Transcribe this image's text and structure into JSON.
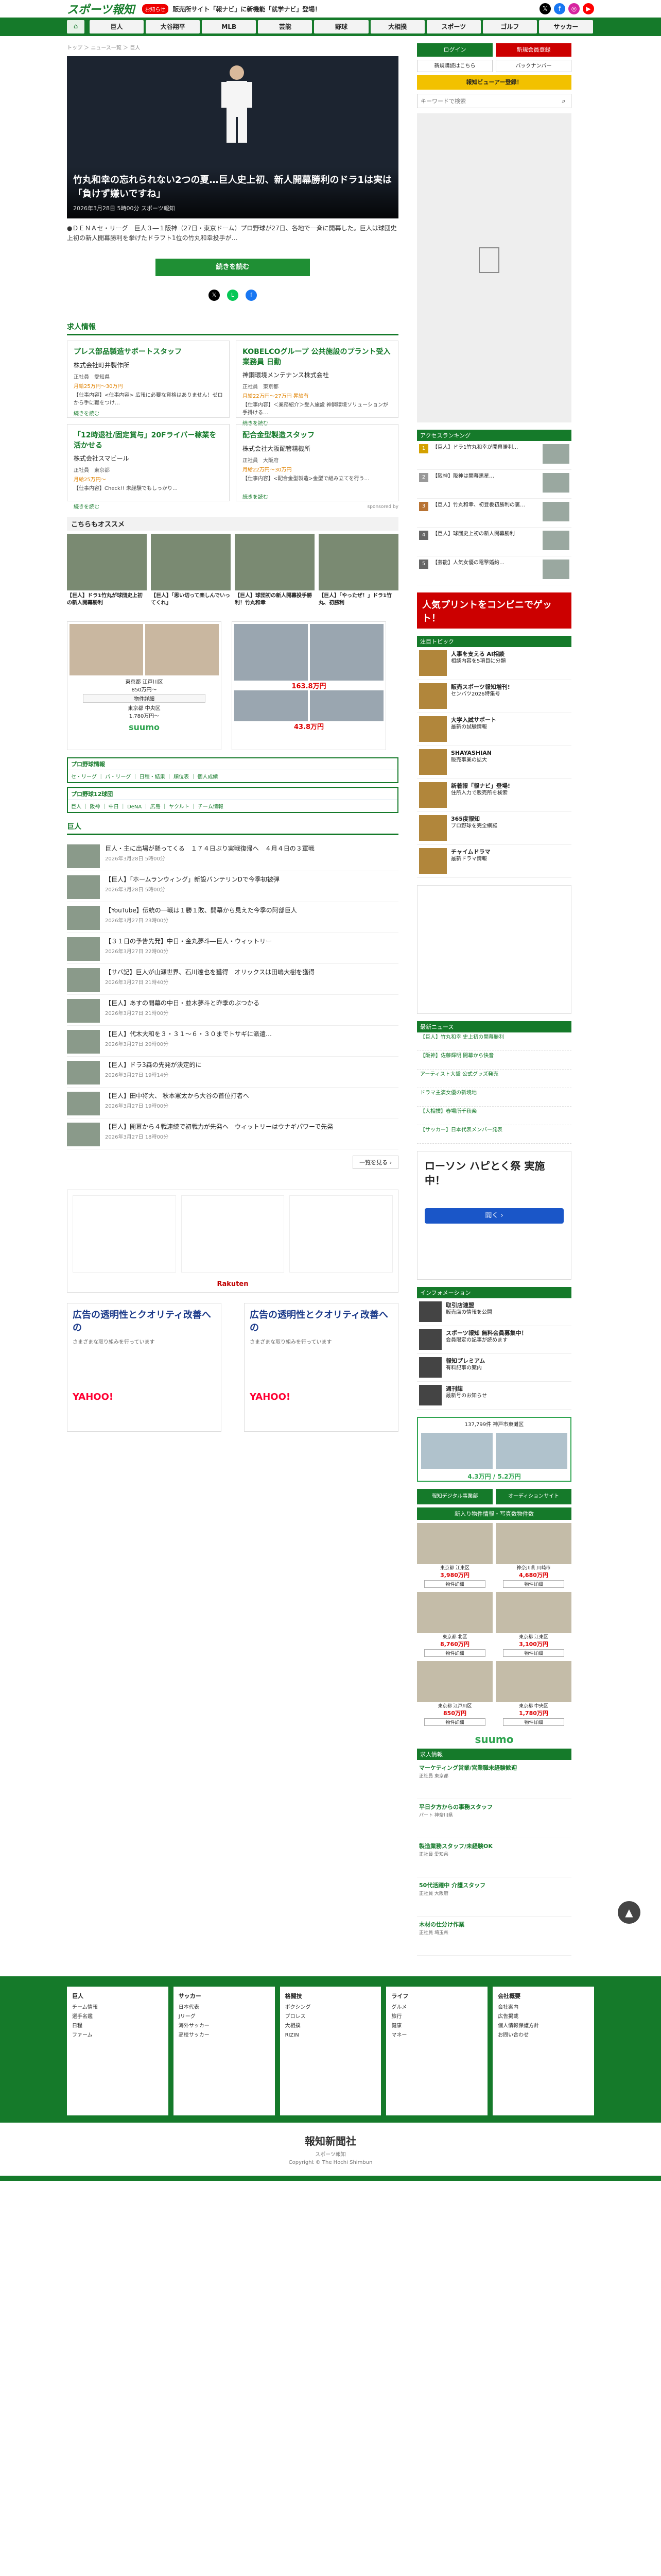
{
  "header": {
    "logo": "スポーツ報知",
    "promo_tag": "お知らせ",
    "promo_text": "販売所サイト「報ナビ」に新機能「就学ナビ」登場！"
  },
  "nav": {
    "home": "⌂",
    "items": [
      "巨人",
      "大谷翔平",
      "MLB",
      "芸能",
      "野球",
      "大相撲",
      "スポーツ",
      "ゴルフ",
      "サッカー"
    ]
  },
  "breadcrumb": "トップ ＞ ニュース一覧 ＞ 巨人",
  "hero": {
    "title": "竹丸和幸の忘れられない2つの夏…巨人史上初、新人開幕勝利のドラ1は実は「負けず嫌いですね」",
    "meta": "2026年3月28日 5時00分 スポーツ報知",
    "lead": "●ＤＥＮＡセ・リーグ　巨人３―１阪神（27日・東京ドーム）プロ野球が27日、各地で一斉に開幕した。巨人は球団史上初の新人開幕勝利を挙げたドラフト1位の竹丸和幸投手が…",
    "more": "続きを読む"
  },
  "jobs_title": "求人情報",
  "jobs": [
    {
      "title": "プレス部品製造サポートスタッフ",
      "company": "株式会社町井製作所",
      "pref": "正社員",
      "loc": "愛知県",
      "salary": "月給25万円〜30万円",
      "desc": "【仕事内容】<仕事内容> 広報に必要な資格はありません！ゼロから手に職をつけ…",
      "more": "続きを読む"
    },
    {
      "title": "KOBELCOグループ 公共施設のプラント受入業務員 日勤",
      "company": "神鋼環境メンテナンス株式会社",
      "pref": "正社員",
      "loc": "東京都",
      "salary": "月給22万円〜27万円 昇給有",
      "desc": "【仕事内容】＜業務紹介＞受入施設 神鋼環境ソリューションが手掛ける…",
      "more": "続きを読む"
    },
    {
      "title": "「12時退社/固定賞与」20Fライバー稼業を活かせる",
      "company": "株式会社スマビール",
      "pref": "正社員",
      "loc": "東京都",
      "salary": "月給25万円〜",
      "desc": "【仕事内容】Check!! 未経験でもしっかり…",
      "more": "続きを読む"
    },
    {
      "title": "配合金型製造スタッフ",
      "company": "株式会社大阪配管精機所",
      "pref": "正社員",
      "loc": "大阪府",
      "salary": "月給22万円〜30万円",
      "desc": "【仕事内容】<配合金型製造>金型で組み立てを行う…",
      "more": "続きを読む"
    }
  ],
  "sponsored": "sponsored by",
  "reco": {
    "title": "こちらもオススメ",
    "items": [
      "【巨人】ドラ1竹丸が球団史上初の新人開幕勝利",
      "【巨人】「思い切って楽しんでいってくれ」",
      "【巨人】球団初の新人開幕投手勝利！竹丸和幸",
      "【巨人】「やったぜ！」ドラ1竹丸、初勝利"
    ]
  },
  "suumo_ad": {
    "p1": "東京都 江戸川区",
    "v1": "850万円〜",
    "p2": "東京都 中央区",
    "v2": "1,780万円〜",
    "btn": "物件詳細",
    "logo": "suumo"
  },
  "car_ad": {
    "p1": "163.8万円",
    "p2": "43.8万円"
  },
  "linkbox1": {
    "h": "プロ野球情報",
    "l": "セ・リーグ ｜ パ・リーグ ｜ 日程・結果 ｜ 順位表 ｜ 個人成績"
  },
  "linkbox2": {
    "h": "プロ野球12球団",
    "l": "巨人 ｜ 阪神 ｜ 中日 ｜ DeNA ｜ 広島 ｜ ヤクルト ｜ チーム情報"
  },
  "news_title": "巨人",
  "news": [
    {
      "t": "巨人・主に出場が懸ってくる　１７４日ぶり実戦復帰へ　４月４日の３軍戦",
      "d": "2026年3月28日 5時00分"
    },
    {
      "t": "【巨人】「ホームランウィング」新設バンテリンDで今季初被弾",
      "d": "2026年3月28日 5時00分"
    },
    {
      "t": "【YouTube】伝統の一戦は１勝１敗、開幕から見えた今季の阿部巨人",
      "d": "2026年3月27日 23時00分"
    },
    {
      "t": "【３１日の予告先発】中日・金丸夢斗―巨人・ウィットリー",
      "d": "2026年3月27日 22時00分"
    },
    {
      "t": "【サバ記】巨人が山瀬世界、石川達也を獲得　オリックスは田嶋大樹を獲得",
      "d": "2026年3月27日 21時40分"
    },
    {
      "t": "【巨人】あすの開幕の中日・並木夢斗と昨季のぶつかる",
      "d": "2026年3月27日 21時00分"
    },
    {
      "t": "【巨人】代木大和を３・３１〜６・３０までトサギに派遣…",
      "d": "2026年3月27日 20時00分"
    },
    {
      "t": "【巨人】ドラ3森の先発が決定的に",
      "d": "2026年3月27日 19時14分"
    },
    {
      "t": "【巨人】田中将大、 秋本憲太から大谷の首位打者へ",
      "d": "2026年3月27日 19時00分"
    },
    {
      "t": "【巨人】開幕から４戦連続で初戦力が先発へ　ウィットリーはウナギパワーで先発",
      "d": "2026年3月27日 18時00分"
    }
  ],
  "list_more": "一覧を見る ›",
  "rakuten_logo": "Rakuten",
  "yahoo_ads": [
    {
      "t": "広告の透明性とクオリティ改善への",
      "s": "さまざまな取り組みを行っています",
      "y": "YAHOO!"
    },
    {
      "t": "広告の透明性とクオリティ改善への",
      "s": "さまざまな取り組みを行っています",
      "y": "YAHOO!"
    }
  ],
  "side": {
    "login": "ログイン",
    "register": "新規会員登録",
    "b1": "新規購読はこちら",
    "b2": "バックナンバー",
    "viewer": "報知ビューアー登録！",
    "search_placeholder": "キーワードで検索",
    "access": "アクセスランキング",
    "ranks": [
      "【巨人】ドラ1竹丸和幸が開幕勝利…",
      "【阪神】阪神は開幕黒星…",
      "【巨人】竹丸和幸、初登板初勝利の裏…",
      "【巨人】球団史上初の新人開幕勝利",
      "【芸能】人気女優の電撃婚約…"
    ],
    "print": "人気プリントをコンビニでゲット！",
    "pr_title": "注目トピック",
    "pr": [
      {
        "b": "人事を支える AI相談",
        "t": "相談内容を5項目に分類"
      },
      {
        "b": "販売スポーツ報知増刊!",
        "t": "センバツ2026特集号"
      },
      {
        "b": "大学入試サポート",
        "t": "最新の試験情報"
      },
      {
        "b": "SHAYASHIAN",
        "t": "販売事業の拡大"
      },
      {
        "b": "新着報「報ナビ」登場!",
        "t": "住所入力で販売所を検索"
      },
      {
        "b": "365度報知",
        "t": "プロ野球を完全網羅"
      },
      {
        "b": "チャイムドラマ",
        "t": "最新ドラマ情報"
      }
    ],
    "recent_title": "最新ニュース",
    "recent": [
      "【巨人】竹丸和幸 史上初の開幕勝利",
      "【阪神】佐藤輝明 開幕から快音",
      "アーティスト大盤 公式グッズ発売",
      "ドラマ主演女優の新境地",
      "【大相撲】春場所千秋楽",
      "【サッカー】日本代表メンバー発表"
    ],
    "lawson_t": "ローソン ハピとく祭 実施中！",
    "lawson_btn": "開く ›",
    "info_title": "インフォメーション",
    "info": [
      {
        "b": "取引店連盟",
        "t": "販売店の情報を公開"
      },
      {
        "b": "スポーツ報知 無料会員募集中！",
        "t": "会員限定の記事が読めます"
      },
      {
        "b": "報知プレミアム",
        "t": "有料記事の案内"
      },
      {
        "b": "週刊誌",
        "t": "最新号のお知らせ"
      }
    ],
    "chintai_h": "137,799件 神戸市東灘区",
    "chintai_p": "4.3万円 / 5.2万円",
    "pair1": "報知デジタル事業部",
    "pair2": "オーディションサイト",
    "prop_title": "新入り物件情報・写真数物件数",
    "props": [
      {
        "a": "東京都 江東区",
        "p": "3,980万円",
        "b": "物件詳細"
      },
      {
        "a": "神奈川県 川崎市",
        "p": "4,680万円",
        "b": "物件詳細"
      },
      {
        "a": "東京都 北区",
        "p": "8,760万円",
        "b": "物件詳細"
      },
      {
        "a": "東京都 江東区",
        "p": "3,100万円",
        "b": "物件詳細"
      },
      {
        "a": "東京都 江戸川区",
        "p": "850万円",
        "b": "物件詳細"
      },
      {
        "a": "東京都 中央区",
        "p": "1,780万円",
        "b": "物件詳細"
      }
    ],
    "suumo": "suumo",
    "jobs_title": "求人情報",
    "jobs": [
      {
        "b": "マーケティング営業/営業職未経験歓迎",
        "t": "正社員 東京都"
      },
      {
        "b": "平日夕方からの事務スタッフ",
        "t": "パート 神奈川県"
      },
      {
        "b": "製造業務スタッフ/未経験OK",
        "t": "正社員 愛知県"
      },
      {
        "b": "50代活躍中 介護スタッフ",
        "t": "正社員 大阪府"
      },
      {
        "b": "木材の仕分け作業",
        "t": "正社員 埼玉県"
      }
    ]
  },
  "footer": {
    "cols": [
      {
        "h": "巨人",
        "items": [
          "チーム情報",
          "選手名鑑",
          "日程",
          "ファーム"
        ]
      },
      {
        "h": "サッカー",
        "items": [
          "日本代表",
          "Jリーグ",
          "海外サッカー",
          "高校サッカー"
        ]
      },
      {
        "h": "格闘技",
        "items": [
          "ボクシング",
          "プロレス",
          "大相撲",
          "RIZIN"
        ]
      },
      {
        "h": "ライフ",
        "items": [
          "グルメ",
          "旅行",
          "健康",
          "マネー"
        ]
      },
      {
        "h": "会社概要",
        "items": [
          "会社案内",
          "広告掲載",
          "個人情報保護方針",
          "お問い合わせ"
        ]
      }
    ],
    "logo": "報知新聞社",
    "sub": "スポーツ報知",
    "copy": "Copyright © The Hochi Shimbun"
  },
  "totop": "▲"
}
